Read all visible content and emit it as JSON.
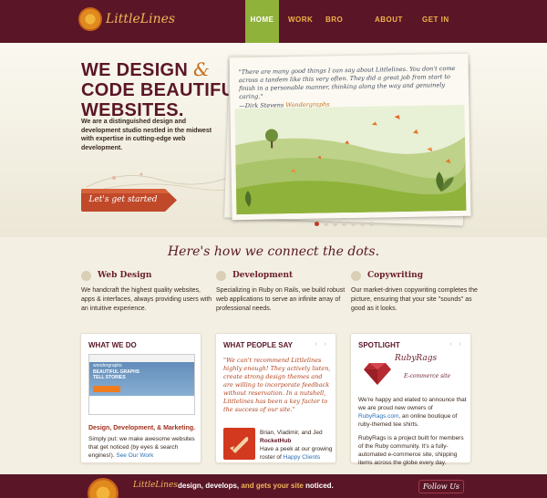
{
  "brand": {
    "name": "LittleLines"
  },
  "nav": {
    "home": "HOME",
    "work": "WORK",
    "blog": "BRO BLOG",
    "about": "ABOUT US",
    "contact": "GET IN TOUCH"
  },
  "hero": {
    "title_line1": "WE DESIGN",
    "amp": "&",
    "title_line2": "CODE BEAUTIFUL",
    "title_line3": "WEBSITES.",
    "description": "We are a distinguished design and development studio nestled in the midwest with expertise in cutting-edge web development.",
    "cta": "Let's get started",
    "quote": "\"There are many good things I can say about Littlelines. You don't come across a tandem like this very often. They did a great job from start to finish in a personable manner, thinking along the way and genuinely caring.\"",
    "quote_author_prefix": "—Dirk Stevens",
    "quote_author_company": "Wondergraphs",
    "slides": {
      "count": 7,
      "active": 1
    }
  },
  "connect": "Here's how we connect the dots.",
  "services": [
    {
      "title": "Web Design",
      "text": "We handcraft the highest quality websites, apps & interfaces, always providing users with an intuitive experience."
    },
    {
      "title": "Development",
      "text": "Specializing in Ruby on Rails, we build robust web applications to serve an infinite array of professional needs."
    },
    {
      "title": "Copywriting",
      "text": "Our market-driven copywriting completes the picture, ensuring that your site \"sounds\" as good as it looks."
    }
  ],
  "what_we_do": {
    "title": "WHAT WE DO",
    "screenshot_brand": "wondergraphs",
    "screenshot_headline": "BEAUTIFUL GRAPHS TELL STORIES",
    "subtitle": "Design, Development, & Marketing.",
    "text": "Simply put: we make awesome websites that get noticed (by eyes & search engines!).",
    "link": "See Our Work"
  },
  "what_people_say": {
    "title": "WHAT PEOPLE SAY",
    "arrows": "‹ ›",
    "quote": "\"We can't recommend Littlelines highly enough! They actively listen, create strong design themes and are willing to incorporate feedback without reservation. In a nutshell, Littlelines has been a key factor to the success of our site.\"",
    "people": "Brian, Vladimir, and Jed",
    "company": "RocketHub",
    "text_before": "Have a peek at our growing roster of",
    "link": "Happy Clients"
  },
  "spotlight": {
    "title": "SPOTLIGHT",
    "arrows": "‹ ›",
    "brand": "RubyRags",
    "tag": "E-commerce site",
    "p1_before": "We're happy and elated to announce that we are proud new owners of",
    "p1_link": "RubyRags.com",
    "p1_after": ", an online boutique of ruby-themed tee shirts.",
    "p2": "RubyRags is a project built for members of the Ruby community. It's a fully-automated e-commerce site, shipping items across the globe every day."
  },
  "footer": {
    "brand": "LittleLines",
    "tag_a": "design, develops,",
    "tag_b": "and gets your site",
    "tag_c": "noticed.",
    "follow": "Follow Us"
  },
  "colors": {
    "maroon": "#5a1626",
    "green": "#8fb23a",
    "orange": "#c36f1e",
    "gold": "#f1b24b"
  }
}
